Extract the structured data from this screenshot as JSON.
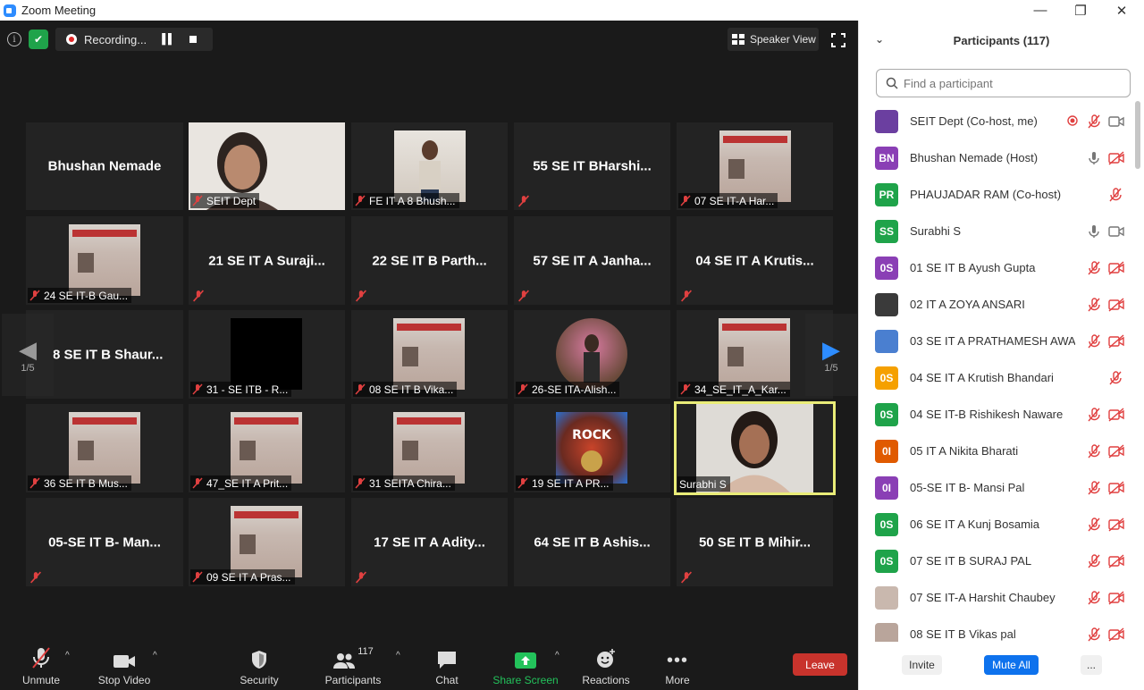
{
  "window": {
    "title": "Zoom Meeting",
    "minimize": "—",
    "maximize": "❐",
    "close": "✕"
  },
  "topbar": {
    "recording_text": "Recording...",
    "speaker_view": "Speaker View"
  },
  "page": {
    "left": "1/5",
    "right": "1/5"
  },
  "tiles": [
    {
      "label": "Bhushan Nemade"
    },
    {
      "label": "SEIT Dept"
    },
    {
      "label": "FE IT A 8 Bhush..."
    },
    {
      "label": "55 SE IT BHarshi..."
    },
    {
      "label": "07 SE IT-A Har..."
    },
    {
      "label": "24 SE IT-B Gau..."
    },
    {
      "label": "21 SE IT A Suraji..."
    },
    {
      "label": "22 SE IT B Parth..."
    },
    {
      "label": "57 SE IT A Janha..."
    },
    {
      "label": "04 SE IT A Krutis..."
    },
    {
      "label": "8 SE IT B Shaur..."
    },
    {
      "label": "31 - SE ITB - R..."
    },
    {
      "label": "08 SE IT B Vika..."
    },
    {
      "label": "26-SE ITA-Alish..."
    },
    {
      "label": "34_SE_IT_A_Kar..."
    },
    {
      "label": "36 SE IT B Mus..."
    },
    {
      "label": "47_SE IT A Prit..."
    },
    {
      "label": "31 SEITA Chira..."
    },
    {
      "label": "19 SE IT A  PR..."
    },
    {
      "label": "Surabhi S"
    },
    {
      "label": "05-SE IT B- Man..."
    },
    {
      "label": "09 SE IT A Pras..."
    },
    {
      "label": "17 SE IT A Adity..."
    },
    {
      "label": "64 SE IT B Ashis..."
    },
    {
      "label": "50 SE IT B Mihir..."
    }
  ],
  "toolbar": {
    "unmute": "Unmute",
    "stop_video": "Stop Video",
    "security": "Security",
    "participants": "Participants",
    "participants_count": "117",
    "chat": "Chat",
    "share_screen": "Share Screen",
    "reactions": "Reactions",
    "more": "More",
    "leave": "Leave"
  },
  "panel": {
    "title": "Participants (117)",
    "search_placeholder": "Find a participant",
    "invite": "Invite",
    "mute_all": "Mute All",
    "more": "...",
    "participants": [
      {
        "initials": "",
        "name": "SEIT Dept (Co-host, me)",
        "color": "#6b3fa0"
      },
      {
        "initials": "BN",
        "name": "Bhushan Nemade (Host)",
        "color": "#8a3fb5"
      },
      {
        "initials": "PR",
        "name": "PHAUJADAR RAM (Co-host)",
        "color": "#1fa34a"
      },
      {
        "initials": "SS",
        "name": "Surabhi S",
        "color": "#1fa34a"
      },
      {
        "initials": "0S",
        "name": "01 SE IT B Ayush Gupta",
        "color": "#8a3fb5"
      },
      {
        "initials": "",
        "name": "02 IT  A ZOYA ANSARI",
        "color": "#3a3a3a"
      },
      {
        "initials": "",
        "name": "03 SE IT A PRATHAMESH AWATI",
        "color": "#4a7fd0"
      },
      {
        "initials": "0S",
        "name": "04 SE IT A Krutish Bhandari",
        "color": "#f5a000"
      },
      {
        "initials": "0S",
        "name": "04 SE IT-B Rishikesh Naware",
        "color": "#1fa34a"
      },
      {
        "initials": "0I",
        "name": "05 IT A Nikita Bharati",
        "color": "#e05a00"
      },
      {
        "initials": "0I",
        "name": "05-SE IT B- Mansi Pal",
        "color": "#8a3fb5"
      },
      {
        "initials": "0S",
        "name": "06 SE IT A Kunj Bosamia",
        "color": "#1fa34a"
      },
      {
        "initials": "0S",
        "name": "07 SE IT B SURAJ PAL",
        "color": "#1fa34a"
      },
      {
        "initials": "",
        "name": "07 SE IT-A Harshit Chaubey",
        "color": "#c9b8ae"
      },
      {
        "initials": "",
        "name": "08 SE IT B Vikas pal",
        "color": "#b9a59b"
      }
    ]
  }
}
